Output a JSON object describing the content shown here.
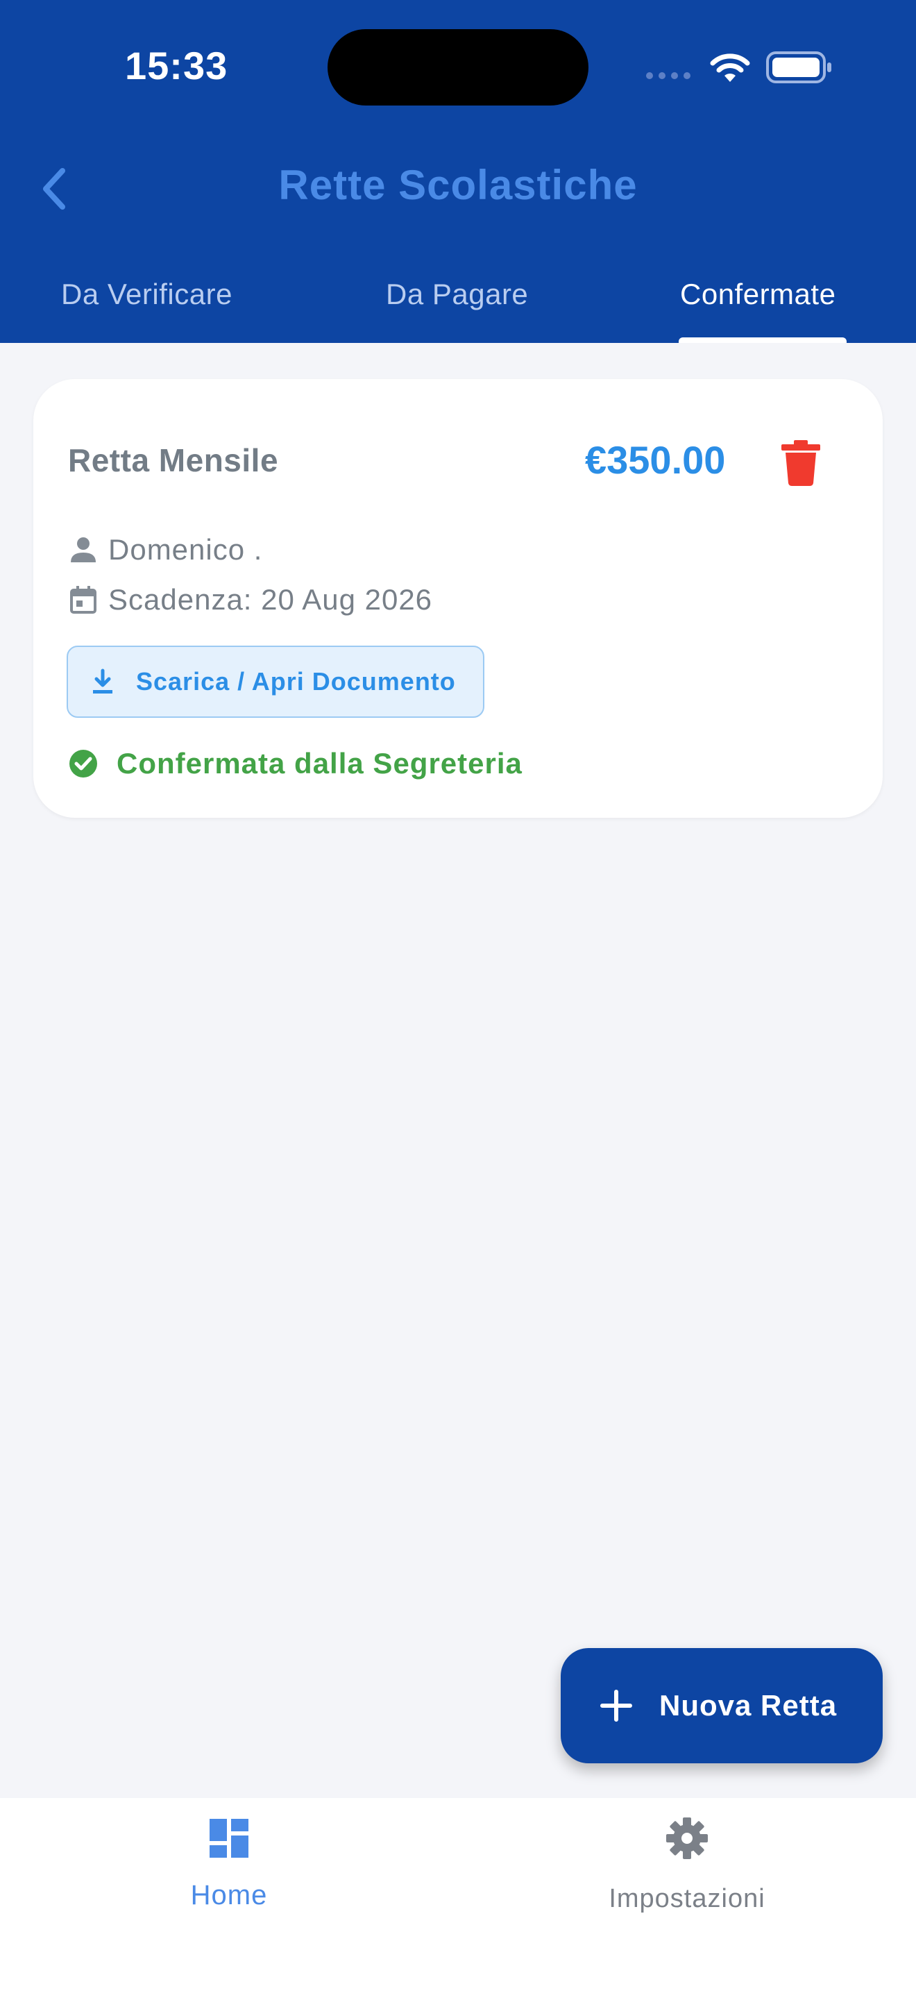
{
  "status_bar": {
    "time": "15:33",
    "icons": [
      "signal-icon",
      "wifi-icon",
      "battery-icon"
    ]
  },
  "header": {
    "title": "Rette Scolastiche",
    "back_icon": "chevron-left-icon"
  },
  "tabs": [
    {
      "label": "Da Verificare",
      "active": false
    },
    {
      "label": "Da Pagare",
      "active": false
    },
    {
      "label": "Confermate",
      "active": true
    }
  ],
  "cards": [
    {
      "title": "Retta Mensile",
      "amount": "€350.00",
      "student": "Domenico .",
      "due_date": "Scadenza: 20 Aug 2026",
      "document_button": "Scarica / Apri Documento",
      "status": "Confermata dalla Segreteria"
    }
  ],
  "fab": {
    "label": "Nuova Retta",
    "icon": "plus-icon"
  },
  "bottom_nav": [
    {
      "label": "Home",
      "icon": "dashboard-icon",
      "active": true
    },
    {
      "label": "Impostazioni",
      "icon": "gear-icon",
      "active": false
    }
  ],
  "colors": {
    "header_bg": "#0d45a3",
    "accent": "#2b8ee6",
    "title_blue": "#4a8ae6",
    "delete_red": "#f03a2e",
    "success_green": "#43a347",
    "page_bg": "#f4f5f9"
  }
}
